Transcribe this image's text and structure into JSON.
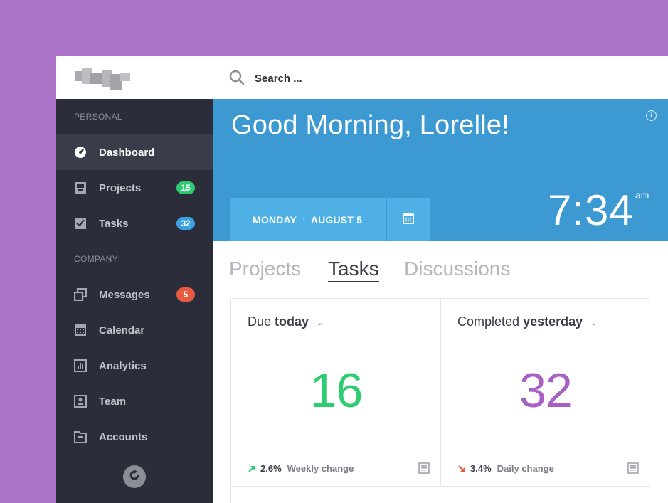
{
  "sidebar": {
    "sections": [
      {
        "label": "PERSONAL"
      },
      {
        "label": "COMPANY"
      }
    ],
    "items": [
      {
        "label": "Dashboard",
        "icon": "gauge-icon",
        "active": true
      },
      {
        "label": "Projects",
        "icon": "inbox-icon",
        "badge": "15",
        "badge_color": "#2ecc71"
      },
      {
        "label": "Tasks",
        "icon": "checkbox-icon",
        "badge": "32",
        "badge_color": "#3aa0e0"
      },
      {
        "label": "Messages",
        "icon": "messages-icon",
        "badge": "5",
        "badge_color": "#e75a42"
      },
      {
        "label": "Calendar",
        "icon": "calendar-icon"
      },
      {
        "label": "Analytics",
        "icon": "analytics-icon"
      },
      {
        "label": "Team",
        "icon": "team-icon"
      },
      {
        "label": "Accounts",
        "icon": "folder-icon"
      }
    ]
  },
  "search": {
    "placeholder": "Search ..."
  },
  "hero": {
    "greeting": "Good Morning, Lorelle!",
    "day": "MONDAY",
    "date": "AUGUST 5",
    "time": "7:34",
    "ampm": "am",
    "bg_color": "#3c99d2"
  },
  "tabs": [
    {
      "label": "Projects",
      "active": false
    },
    {
      "label": "Tasks",
      "active": true
    },
    {
      "label": "Discussions",
      "active": false
    }
  ],
  "cards": [
    {
      "title_prefix": "Due",
      "title_strong": "today",
      "value": "16",
      "value_color": "#2ecc71",
      "pct": "2.6%",
      "change_label": "Weekly change",
      "trend": "up"
    },
    {
      "title_prefix": "Completed",
      "title_strong": "yesterday",
      "value": "32",
      "value_color": "#a860c4",
      "pct": "3.4%",
      "change_label": "Daily change",
      "trend": "down"
    }
  ]
}
